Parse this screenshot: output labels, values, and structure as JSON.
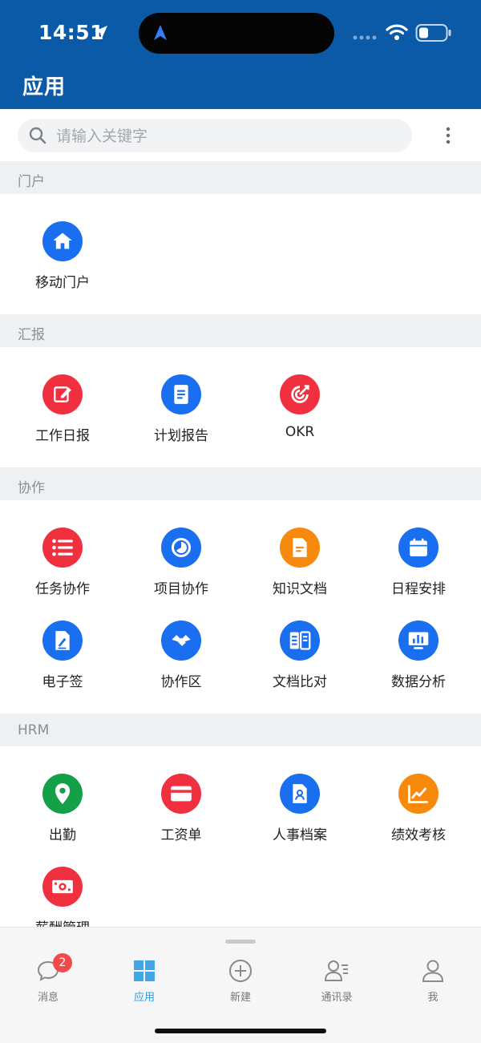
{
  "status_bar": {
    "time": "14:51"
  },
  "header": {
    "title": "应用"
  },
  "search": {
    "placeholder": "请输入关键字"
  },
  "sections": [
    {
      "title": "门户",
      "apps": [
        {
          "label": "移动门户",
          "icon": "home-icon",
          "color": "#1a6ef0"
        }
      ]
    },
    {
      "title": "汇报",
      "apps": [
        {
          "label": "工作日报",
          "icon": "edit-icon",
          "color": "#f0303e"
        },
        {
          "label": "计划报告",
          "icon": "document-icon",
          "color": "#1a6ef0"
        },
        {
          "label": "OKR",
          "icon": "target-icon",
          "color": "#f0303e"
        }
      ]
    },
    {
      "title": "协作",
      "apps": [
        {
          "label": "任务协作",
          "icon": "list-icon",
          "color": "#f0303e"
        },
        {
          "label": "项目协作",
          "icon": "clock-icon",
          "color": "#1a6ef0"
        },
        {
          "label": "知识文档",
          "icon": "file-icon",
          "color": "#f78a0c"
        },
        {
          "label": "日程安排",
          "icon": "calendar-icon",
          "color": "#1a6ef0"
        },
        {
          "label": "电子签",
          "icon": "sign-icon",
          "color": "#1a6ef0"
        },
        {
          "label": "协作区",
          "icon": "handshake-icon",
          "color": "#1a6ef0"
        },
        {
          "label": "文档比对",
          "icon": "compare-icon",
          "color": "#1a6ef0"
        },
        {
          "label": "数据分析",
          "icon": "chart-icon",
          "color": "#1a6ef0"
        }
      ]
    },
    {
      "title": "HRM",
      "apps": [
        {
          "label": "出勤",
          "icon": "location-icon",
          "color": "#14a046"
        },
        {
          "label": "工资单",
          "icon": "card-icon",
          "color": "#f0303e"
        },
        {
          "label": "人事档案",
          "icon": "profile-icon",
          "color": "#1a6ef0"
        },
        {
          "label": "绩效考核",
          "icon": "trend-icon",
          "color": "#f78a0c"
        },
        {
          "label": "薪酬管理",
          "icon": "money-icon",
          "color": "#f0303e"
        }
      ]
    }
  ],
  "tabbar": {
    "tabs": [
      {
        "label": "消息",
        "badge": "2"
      },
      {
        "label": "应用"
      },
      {
        "label": "新建"
      },
      {
        "label": "通讯录"
      },
      {
        "label": "我"
      }
    ]
  }
}
